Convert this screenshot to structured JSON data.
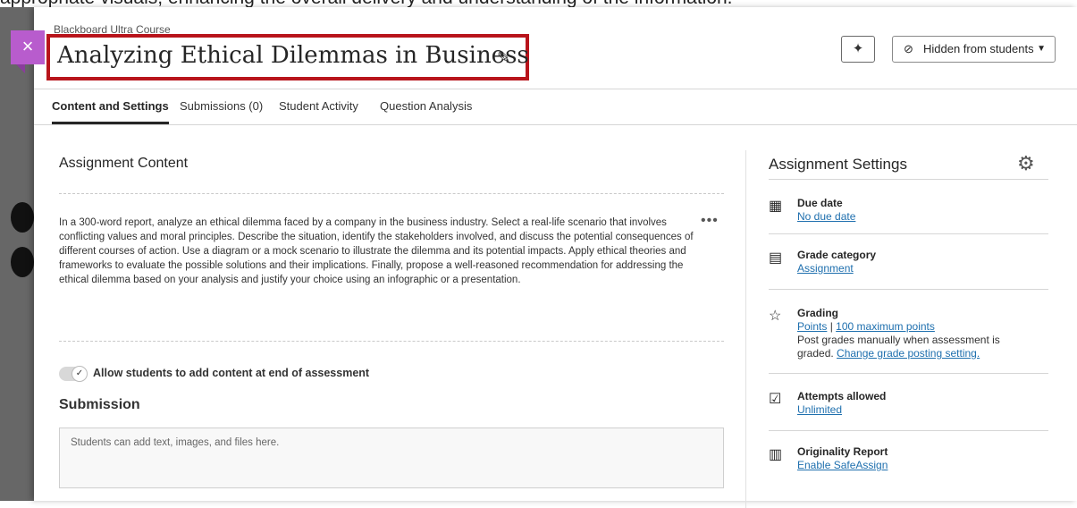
{
  "top_text": "appropriate visuals, enhancing the overall delivery and understanding of the information.",
  "course": {
    "label": "Blackboard Ultra Course"
  },
  "close_label": "×",
  "title": "Analyzing Ethical Dilemmas in Business",
  "header": {
    "spark_icon": "sparkle-icon",
    "visibility_label": "Hidden from students"
  },
  "tabs": [
    {
      "label": "Content and Settings"
    },
    {
      "label": "Submissions (0)"
    },
    {
      "label": "Student Activity"
    },
    {
      "label": "Question Analysis"
    }
  ],
  "content": {
    "heading": "Assignment Content",
    "description": "In a 300-word report, analyze an ethical dilemma faced by a company in the business industry. Select a real-life scenario that involves conflicting values and moral principles. Describe the situation, identify the stakeholders involved, and discuss the potential consequences of different courses of action. Use a diagram or a mock scenario to illustrate the dilemma and its potential impacts. Apply ethical theories and frameworks to evaluate the possible solutions and their implications. Finally, propose a well-reasoned recommendation for addressing the ethical dilemma based on your analysis and justify your choice using an infographic or a presentation.",
    "more_label": "•••",
    "toggle_label": "Allow students to add content at end of assessment",
    "submission_heading": "Submission",
    "submission_placeholder": "Students can add text, images, and files here."
  },
  "settings": {
    "heading": "Assignment Settings",
    "items": [
      {
        "title": "Due date",
        "link": "No due date",
        "icon": "calendar-icon"
      },
      {
        "title": "Grade category",
        "link": "Assignment",
        "icon": "document-icon"
      },
      {
        "title": "Grading",
        "link1": "Points",
        "sep": "|",
        "link2": "100 maximum points",
        "desc": "Post grades manually when assessment is graded.",
        "link3": "Change grade posting setting.",
        "icon": "grading-icon"
      },
      {
        "title": "Attempts allowed",
        "link": "Unlimited",
        "icon": "checkbox-icon"
      },
      {
        "title": "Originality Report",
        "link": "Enable SafeAssign",
        "icon": "originality-icon"
      }
    ]
  },
  "colors": {
    "accent": "#b85ccd",
    "highlight_border": "#b8141b",
    "link": "#1e6fae"
  }
}
